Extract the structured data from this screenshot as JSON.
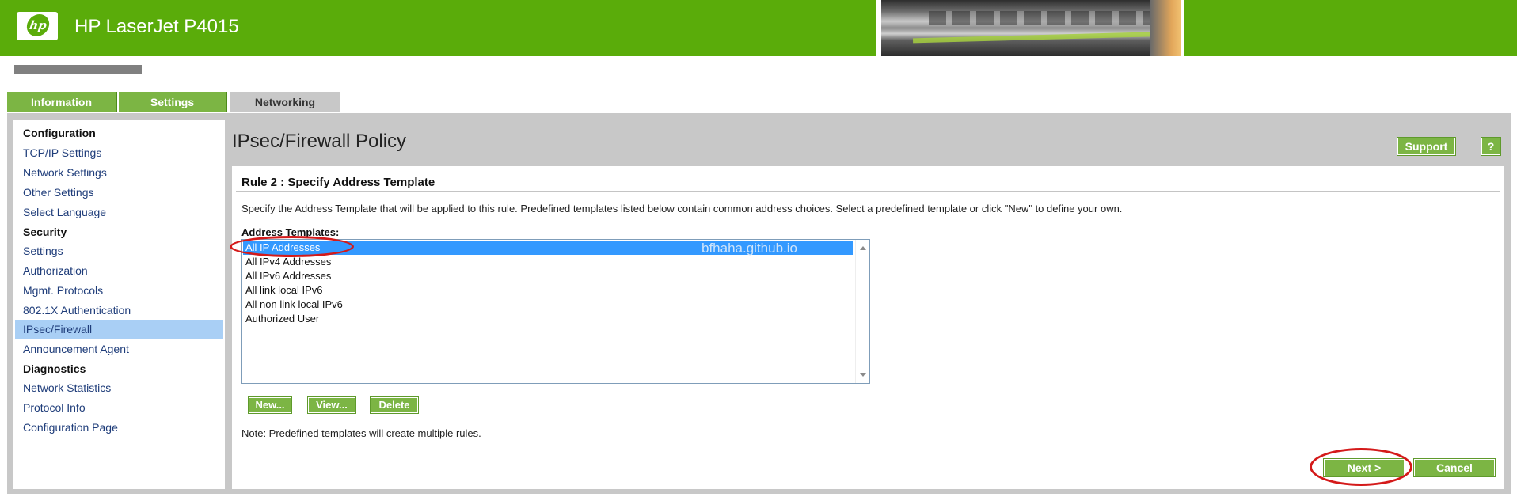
{
  "header": {
    "logo_text": "hp",
    "product_name": "HP LaserJet P4015"
  },
  "tabs": [
    {
      "label": "Information"
    },
    {
      "label": "Settings"
    },
    {
      "label": "Networking"
    }
  ],
  "sidebar": {
    "sections": [
      {
        "heading": "Configuration",
        "items": [
          "TCP/IP Settings",
          "Network Settings",
          "Other Settings",
          "Select Language"
        ]
      },
      {
        "heading": "Security",
        "items": [
          "Settings",
          "Authorization",
          "Mgmt. Protocols",
          "802.1X Authentication",
          "IPsec/Firewall",
          "Announcement Agent"
        ]
      },
      {
        "heading": "Diagnostics",
        "items": [
          "Network Statistics",
          "Protocol Info",
          "Configuration Page"
        ]
      }
    ],
    "selected_item": "IPsec/Firewall"
  },
  "main": {
    "page_title": "IPsec/Firewall Policy",
    "support_label": "Support",
    "help_label": "?",
    "panel_title": "Rule 2 : Specify Address Template",
    "description": "Specify the Address Template that will be applied to this rule. Predefined templates listed below contain common address choices. Select a predefined template or click \"New\" to define your own.",
    "list_label": "Address Templates:",
    "templates": [
      "All IP Addresses",
      "All IPv4 Addresses",
      "All IPv6 Addresses",
      "All link local IPv6",
      "All non link local IPv6",
      "Authorized User"
    ],
    "selected_template": "All IP Addresses",
    "watermark": "bfhaha.github.io",
    "buttons": {
      "new": "New...",
      "view": "View...",
      "delete": "Delete"
    },
    "note": "Note: Predefined templates will create multiple rules.",
    "next_label": "Next >",
    "cancel_label": "Cancel"
  },
  "colors": {
    "brand_green": "#5aac0a",
    "button_green": "#7cb544",
    "selection_blue": "#3399ff",
    "sidebar_selected": "#a9cff5",
    "annotation_red": "#d41a1a"
  }
}
